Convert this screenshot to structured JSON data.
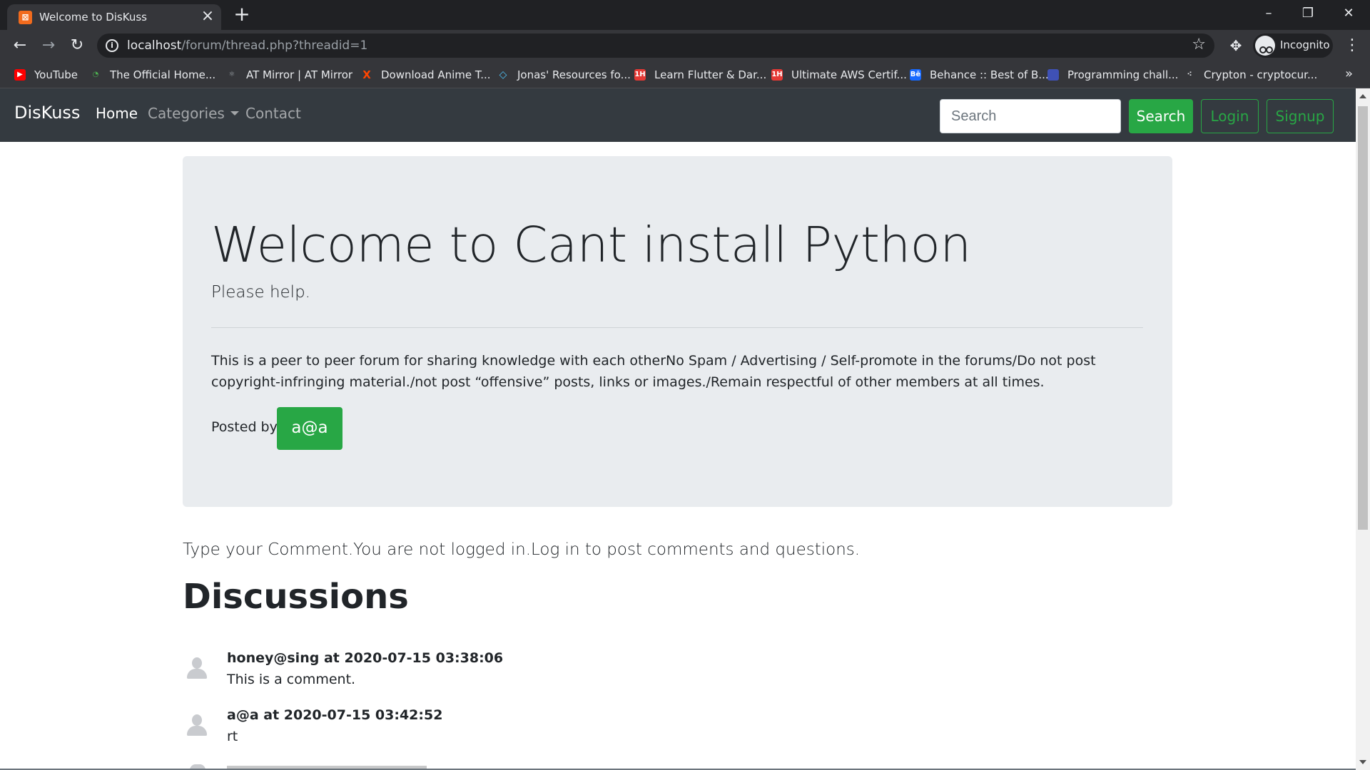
{
  "browser": {
    "tab_title": "Welcome to DisKuss",
    "url_host": "localhost",
    "url_path": "/forum/thread.php?threadid=1",
    "profile_label": "Incognito",
    "bookmarks": [
      {
        "label": "YouTube",
        "icon": "youtube-icon",
        "color": "#ff0000"
      },
      {
        "label": "The Official Home...",
        "icon": "site-icon",
        "color": "#4caf50"
      },
      {
        "label": "AT Mirror | AT Mirror",
        "icon": "mirror-icon",
        "color": "#9aa0a6"
      },
      {
        "label": "Download Anime T...",
        "icon": "x-icon",
        "color": "#ff4500"
      },
      {
        "label": "Jonas' Resources fo...",
        "icon": "diamond-icon",
        "color": "#4fc3f7"
      },
      {
        "label": "Learn Flutter & Dar...",
        "icon": "1h-icon",
        "color": "#e53935"
      },
      {
        "label": "Ultimate AWS Certif...",
        "icon": "1h-icon",
        "color": "#e53935"
      },
      {
        "label": "Behance :: Best of B...",
        "icon": "behance-icon",
        "color": "#1769ff"
      },
      {
        "label": "Programming chall...",
        "icon": "site-icon",
        "color": "#3f51b5"
      },
      {
        "label": "Crypton - cryptocur...",
        "icon": "crypto-icon",
        "color": "#e8eaed"
      }
    ]
  },
  "navbar": {
    "brand": "DisKuss",
    "links": {
      "home": "Home",
      "categories": "Categories",
      "contact": "Contact"
    },
    "search_placeholder": "Search",
    "search_button": "Search",
    "login_button": "Login",
    "signup_button": "Signup"
  },
  "thread": {
    "title": "Welcome to Cant install Python",
    "lead": "Please help.",
    "description": "This is a peer to peer forum for sharing knowledge with each otherNo Spam / Advertising / Self-promote in the forums/Do not post copyright-infringing material./not post “offensive” posts, links or images./Remain respectful of other members at all times.",
    "posted_by_label": "Posted by",
    "author": "a@a"
  },
  "comment_notice": "Type your Comment.You are not logged in.Log in to post comments and questions.",
  "discussions": {
    "title": "Discussions",
    "comments": [
      {
        "header": "honey@sing at 2020-07-15 03:38:06",
        "text": "This is a comment."
      },
      {
        "header": "a@a at 2020-07-15 03:42:52",
        "text": "rt"
      }
    ]
  },
  "colors": {
    "success": "#28a745",
    "navbar": "#343a40",
    "jumbotron": "#e9ecef"
  }
}
